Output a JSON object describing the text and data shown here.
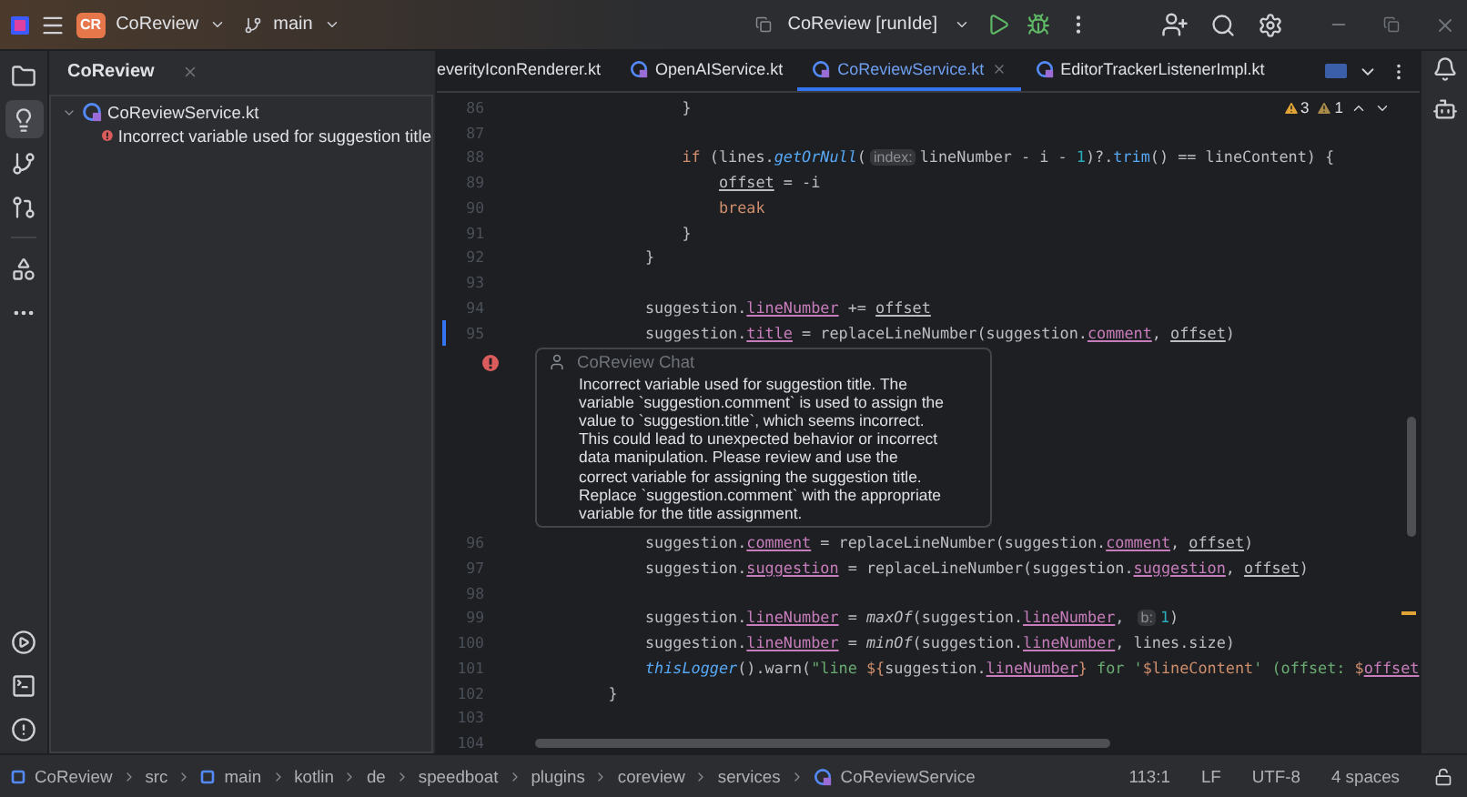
{
  "title_bar": {
    "project_badge": "CR",
    "project": "CoReview",
    "branch": "main",
    "run_configuration": "CoReview [runIde]"
  },
  "left_toolbar": [
    {
      "selected": false
    },
    {
      "selected": true
    },
    {
      "selected": false
    },
    {
      "selected": false
    },
    {
      "selected": false
    },
    {
      "selected": false
    },
    {
      "selected": false
    },
    {
      "selected": false
    },
    {
      "selected": false
    }
  ],
  "project_panel": {
    "title": "CoReview",
    "tree": [
      {
        "label": "CoReviewService.kt",
        "expanded": true,
        "children": [
          {
            "label": "Incorrect variable used for suggestion title"
          }
        ]
      }
    ]
  },
  "tabs": [
    {
      "label": "everityIconRenderer.kt",
      "selected": false
    },
    {
      "label": "OpenAIService.kt",
      "selected": false
    },
    {
      "label": "CoReviewService.kt",
      "selected": true
    },
    {
      "label": "EditorTrackerListenerImpl.kt",
      "selected": false
    }
  ],
  "editor": {
    "problems": [
      {
        "kind": "warning",
        "count": "3"
      },
      {
        "kind": "weak_warning",
        "count": "1"
      }
    ],
    "lines": [
      {
        "kind": "code",
        "number": "86",
        "changed": false,
        "tokens": [
          {
            "kind": "text",
            "text": "            }"
          }
        ]
      },
      {
        "kind": "code",
        "number": "87",
        "changed": false
      },
      {
        "kind": "code",
        "number": "88",
        "changed": false,
        "tokens": [
          {
            "kind": "keyword",
            "text": "            if"
          },
          {
            "kind": "text",
            "text": " (lines."
          },
          {
            "kind": "call",
            "text": "getOrNull"
          },
          {
            "kind": "text",
            "text": "("
          },
          {
            "kind": "hint",
            "text": "index:"
          },
          {
            "kind": "text",
            "text": "lineNumber - i - "
          },
          {
            "kind": "number",
            "text": "1"
          },
          {
            "kind": "text",
            "text": ")?."
          },
          {
            "kind": "method",
            "text": "trim"
          },
          {
            "kind": "text",
            "text": "() == lineContent) {"
          }
        ]
      },
      {
        "kind": "code",
        "number": "89",
        "changed": false,
        "tokens": [
          {
            "kind": "variable",
            "text": "                offset"
          },
          {
            "kind": "text",
            "text": " = -i"
          }
        ]
      },
      {
        "kind": "code",
        "number": "90",
        "changed": false,
        "tokens": [
          {
            "kind": "keyword",
            "text": "                break"
          }
        ]
      },
      {
        "kind": "code",
        "number": "91",
        "changed": false,
        "tokens": [
          {
            "kind": "text",
            "text": "            }"
          }
        ]
      },
      {
        "kind": "code",
        "number": "92",
        "changed": false,
        "tokens": [
          {
            "kind": "text",
            "text": "        }"
          }
        ]
      },
      {
        "kind": "code",
        "number": "93",
        "changed": false
      },
      {
        "kind": "code",
        "number": "94",
        "changed": false,
        "tokens": [
          {
            "kind": "text",
            "text": "        suggestion."
          },
          {
            "kind": "field",
            "text": "lineNumber"
          },
          {
            "kind": "text",
            "text": " += "
          },
          {
            "kind": "variable",
            "text": "offset"
          }
        ]
      },
      {
        "kind": "code",
        "number": "95",
        "changed": true,
        "tokens": [
          {
            "kind": "text",
            "text": "        suggestion."
          },
          {
            "kind": "field",
            "text": "title"
          },
          {
            "kind": "text",
            "text": " = replaceLineNumber(suggestion."
          },
          {
            "kind": "field",
            "text": "comment"
          },
          {
            "kind": "text",
            "text": ", "
          },
          {
            "kind": "variable",
            "text": "offset"
          },
          {
            "kind": "text",
            "text": ")"
          }
        ]
      },
      {
        "kind": "comment",
        "author": "CoReview Chat",
        "text": "Incorrect variable used for suggestion title. The variable `suggestion.comment` is used to assign the value to `suggestion.title`, which seems incorrect. This could lead to unexpected behavior or incorrect data manipulation. Please review and use the correct variable for assigning the suggestion title. Replace `suggestion.comment` with the appropriate variable for the title assignment."
      },
      {
        "kind": "code",
        "number": "96",
        "changed": false,
        "tokens": [
          {
            "kind": "text",
            "text": "        suggestion."
          },
          {
            "kind": "field",
            "text": "comment"
          },
          {
            "kind": "text",
            "text": " = replaceLineNumber(suggestion."
          },
          {
            "kind": "field",
            "text": "comment"
          },
          {
            "kind": "text",
            "text": ", "
          },
          {
            "kind": "variable",
            "text": "offset"
          },
          {
            "kind": "text",
            "text": ")"
          }
        ]
      },
      {
        "kind": "code",
        "number": "97",
        "changed": false,
        "tokens": [
          {
            "kind": "text",
            "text": "        suggestion."
          },
          {
            "kind": "field",
            "text": "suggestion"
          },
          {
            "kind": "text",
            "text": " = replaceLineNumber(suggestion."
          },
          {
            "kind": "field",
            "text": "suggestion"
          },
          {
            "kind": "text",
            "text": ", "
          },
          {
            "kind": "variable",
            "text": "offset"
          },
          {
            "kind": "text",
            "text": ")"
          }
        ]
      },
      {
        "kind": "code",
        "number": "98",
        "changed": false
      },
      {
        "kind": "code",
        "number": "99",
        "changed": false,
        "tokens": [
          {
            "kind": "text",
            "text": "        suggestion."
          },
          {
            "kind": "field",
            "text": "lineNumber"
          },
          {
            "kind": "text",
            "text": " = "
          },
          {
            "kind": "italic",
            "text": "maxOf"
          },
          {
            "kind": "text",
            "text": "(suggestion."
          },
          {
            "kind": "field",
            "text": "lineNumber"
          },
          {
            "kind": "text",
            "text": ", "
          },
          {
            "kind": "hint",
            "text": "b:"
          },
          {
            "kind": "number",
            "text": "1"
          },
          {
            "kind": "text",
            "text": ")"
          }
        ]
      },
      {
        "kind": "code",
        "number": "100",
        "changed": false,
        "tokens": [
          {
            "kind": "text",
            "text": "        suggestion."
          },
          {
            "kind": "field",
            "text": "lineNumber"
          },
          {
            "kind": "text",
            "text": " = "
          },
          {
            "kind": "italic",
            "text": "minOf"
          },
          {
            "kind": "text",
            "text": "(suggestion."
          },
          {
            "kind": "field",
            "text": "lineNumber"
          },
          {
            "kind": "text",
            "text": ", lines.size)"
          }
        ]
      },
      {
        "kind": "code",
        "number": "101",
        "changed": false,
        "tokens": [
          {
            "kind": "call",
            "text": "        thisLogger"
          },
          {
            "kind": "text",
            "text": "().warn("
          },
          {
            "kind": "string",
            "text": "\"line "
          },
          {
            "kind": "template",
            "text": "${"
          },
          {
            "kind": "text",
            "text": "suggestion."
          },
          {
            "kind": "field",
            "text": "lineNumber"
          },
          {
            "kind": "template",
            "text": "}"
          },
          {
            "kind": "string",
            "text": " for '"
          },
          {
            "kind": "template",
            "text": "$lineContent"
          },
          {
            "kind": "string",
            "text": "' (offset: "
          },
          {
            "kind": "template",
            "text": "$"
          },
          {
            "kind": "field",
            "text": "offset"
          }
        ]
      },
      {
        "kind": "code",
        "number": "102",
        "changed": false,
        "tokens": [
          {
            "kind": "text",
            "text": "    }"
          }
        ]
      },
      {
        "kind": "code",
        "number": "103",
        "changed": false
      },
      {
        "kind": "code",
        "number": "104",
        "changed": false
      }
    ]
  },
  "breadcrumbs": [
    {
      "label": "CoReview",
      "kind": "module"
    },
    {
      "label": "src",
      "kind": "folder"
    },
    {
      "label": "main",
      "kind": "module"
    },
    {
      "label": "kotlin",
      "kind": "folder"
    },
    {
      "label": "de",
      "kind": "folder"
    },
    {
      "label": "speedboat",
      "kind": "folder"
    },
    {
      "label": "plugins",
      "kind": "folder"
    },
    {
      "label": "coreview",
      "kind": "folder"
    },
    {
      "label": "services",
      "kind": "folder"
    },
    {
      "label": "CoReviewService",
      "kind": "class"
    }
  ],
  "status": [
    "113:1",
    "LF",
    "UTF-8",
    "4 spaces"
  ]
}
